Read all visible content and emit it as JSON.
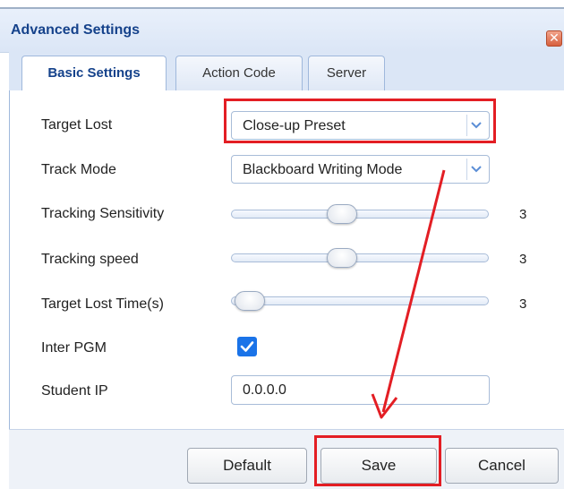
{
  "dialog": {
    "title": "Advanced Settings",
    "close_icon": "close-icon",
    "close_label": "✕"
  },
  "tabs": [
    {
      "label": "Basic Settings",
      "active": true
    },
    {
      "label": "Action Code",
      "active": false
    },
    {
      "label": "Server",
      "active": false
    }
  ],
  "form": {
    "target_lost": {
      "label": "Target Lost",
      "value": "Close-up Preset"
    },
    "track_mode": {
      "label": "Track Mode",
      "value": "Blackboard Writing Mode"
    },
    "tracking_sensitivity": {
      "label": "Tracking Sensitivity",
      "value": "3",
      "level": 0.43
    },
    "tracking_speed": {
      "label": "Tracking speed",
      "value": "3",
      "level": 0.43
    },
    "target_lost_time": {
      "label": "Target Lost Time(s)",
      "value": "3",
      "level": 0.07
    },
    "inter_pgm": {
      "label": "Inter PGM",
      "checked": true
    },
    "student_ip": {
      "label": "Student IP",
      "value": "0.0.0.0"
    }
  },
  "buttons": {
    "default_label": "Default",
    "save_label": "Save",
    "cancel_label": "Cancel"
  },
  "colors": {
    "accent": "#15428b",
    "annotation": "#e31e24",
    "checkbox": "#1a73e8"
  }
}
